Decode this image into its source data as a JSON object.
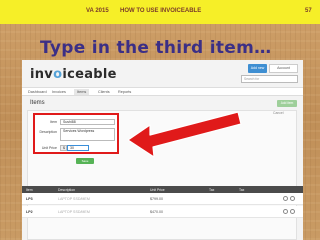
{
  "slide": {
    "course": "VA 2015",
    "topic": "HOW TO USE INVOICEABLE",
    "page_number": "57",
    "title": "Type in the third item…"
  },
  "app": {
    "logo_text_pre": "inv",
    "logo_text_o": "o",
    "logo_text_post": "iceable",
    "add_new_label": "Add new",
    "account_label": "Account",
    "search_placeholder": "Search for",
    "nav": [
      "Dashboard",
      "Invoices",
      "Items",
      "Clients",
      "Reports"
    ],
    "active_nav": "Items",
    "section_title": "Items",
    "add_item_label": "Add item",
    "cancel_label": "Cancel"
  },
  "form": {
    "item_label": "Item",
    "item_value": "Sushi88",
    "description_label": "Description",
    "description_value": "Services Wordpress",
    "unit_price_label": "Unit Price",
    "currency_symbol": "$",
    "unit_price_value": "30",
    "save_label": "Save Changes"
  },
  "table": {
    "headers": [
      "Item",
      "Description",
      "Unit Price",
      "Tax",
      "Tax"
    ],
    "rows": [
      {
        "code": "LP3",
        "description": "LAPTOP SSD/MEM",
        "price": "$799.00"
      },
      {
        "code": "LP2",
        "description": "LAPTOP SSD/MEM",
        "price": "$470.00"
      }
    ]
  },
  "colors": {
    "top_bar": "#f6ef28",
    "title": "#3b2f86",
    "highlight": "#e01a1a",
    "accent_blue": "#3f8fd2",
    "save_green": "#56b356"
  }
}
